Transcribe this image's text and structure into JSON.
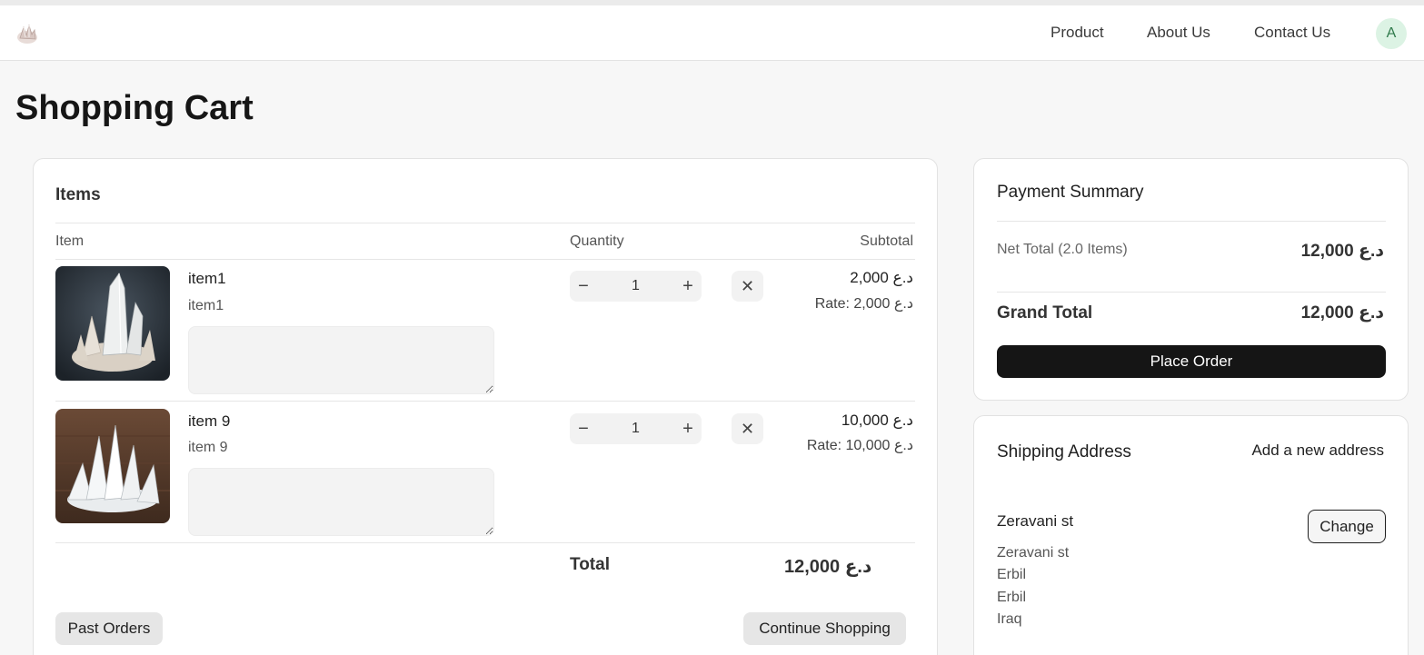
{
  "nav": {
    "links": [
      "Product",
      "About Us",
      "Contact Us"
    ],
    "avatar_letter": "A"
  },
  "page_title": "Shopping Cart",
  "cart": {
    "title": "Items",
    "columns": {
      "item": "Item",
      "quantity": "Quantity",
      "subtotal": "Subtotal"
    },
    "items": [
      {
        "name": "item1",
        "description": "item1",
        "quantity": "1",
        "subtotal": "د.ع 2,000",
        "rate": "Rate: د.ع 2,000",
        "note": ""
      },
      {
        "name": "item 9",
        "description": "item 9",
        "quantity": "1",
        "subtotal": "د.ع 10,000",
        "rate": "Rate: د.ع 10,000",
        "note": ""
      }
    ],
    "total_label": "Total",
    "total_value": "د.ع 12,000",
    "past_orders_label": "Past Orders",
    "continue_shopping_label": "Continue Shopping"
  },
  "payment": {
    "title": "Payment Summary",
    "net_total_label": "Net Total (2.0 Items)",
    "net_total_value": "د.ع 12,000",
    "grand_total_label": "Grand Total",
    "grand_total_value": "د.ع 12,000",
    "place_order_label": "Place Order"
  },
  "shipping": {
    "title": "Shipping Address",
    "add_new_label": "Add a new address",
    "address_name": "Zeravani st",
    "change_label": "Change",
    "lines": [
      "Zeravani st",
      "Erbil",
      "Erbil",
      "Iraq"
    ]
  },
  "icons": {
    "minus": "minus-icon",
    "plus": "plus-icon",
    "remove": "close-icon"
  }
}
